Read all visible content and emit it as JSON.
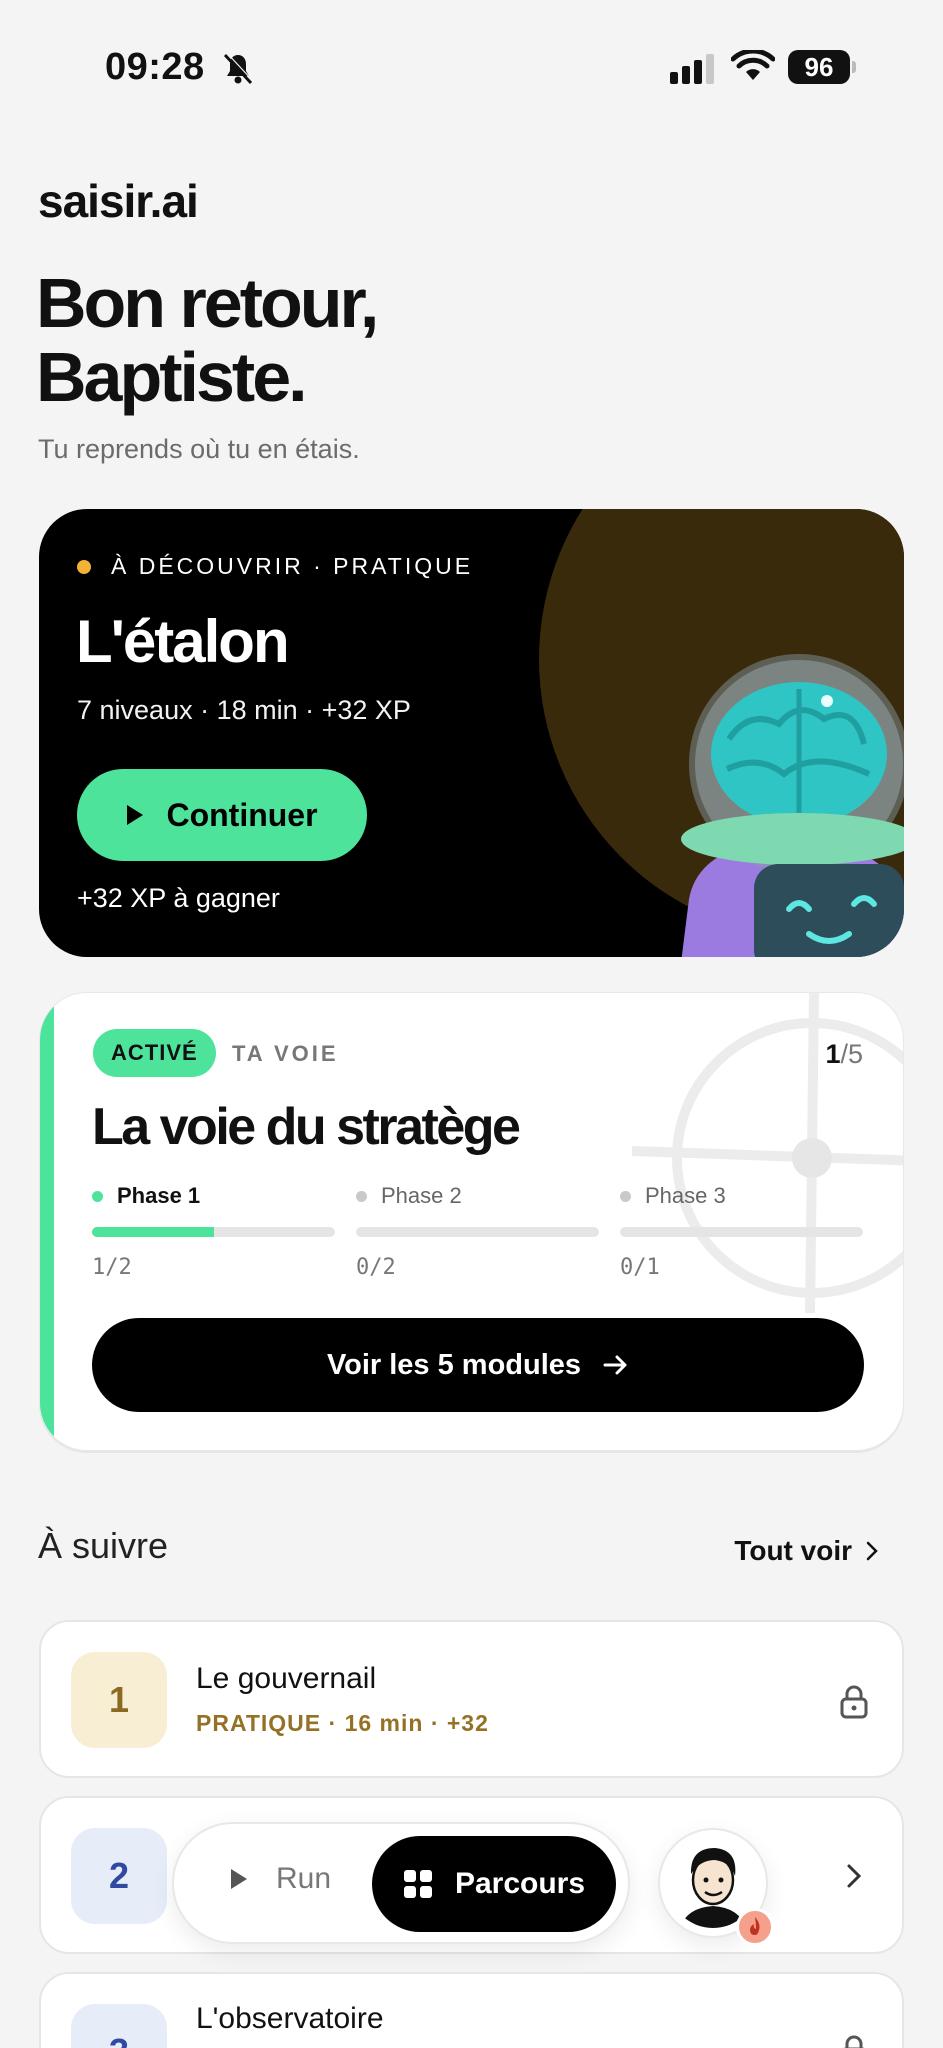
{
  "status_bar": {
    "time": "09:28",
    "battery": "96"
  },
  "brand": "saisir.ai",
  "greeting": {
    "line1": "Bon retour,",
    "line2": "Baptiste.",
    "subtitle": "Tu reprends où tu en étais."
  },
  "hero": {
    "eyebrow": "À DÉCOUVRIR · PRATIQUE",
    "title": "L'étalon",
    "meta": "7 niveaux · 18 min · +32 XP",
    "cta_label": "Continuer",
    "reward": "+32 XP à gagner",
    "colors": {
      "accent": "#4de39b",
      "dot": "#f2b233"
    }
  },
  "path": {
    "badge": "ACTIVÉ",
    "label": "TA VOIE",
    "count_current": "1",
    "count_total": "/5",
    "title": "La voie du stratège",
    "phases": [
      {
        "name": "Phase 1",
        "progress": "1/2",
        "fraction": 0.5
      },
      {
        "name": "Phase 2",
        "progress": "0/2",
        "fraction": 0
      },
      {
        "name": "Phase 3",
        "progress": "0/1",
        "fraction": 0
      }
    ],
    "modules_button": "Voir les 5 modules"
  },
  "next": {
    "section_title": "À suivre",
    "see_all": "Tout voir",
    "items": [
      {
        "number": "1",
        "title": "Le gouvernail",
        "subtitle": "PRATIQUE · 16 min · +32",
        "icon": "lock-icon",
        "color": "#957125"
      },
      {
        "number": "2",
        "icon": "chevron-right-icon"
      },
      {
        "number": "3",
        "title": "L'observatoire",
        "icon": "lock-icon"
      }
    ]
  },
  "bottom_nav": {
    "run_label": "Run",
    "parcours_label": "Parcours"
  }
}
